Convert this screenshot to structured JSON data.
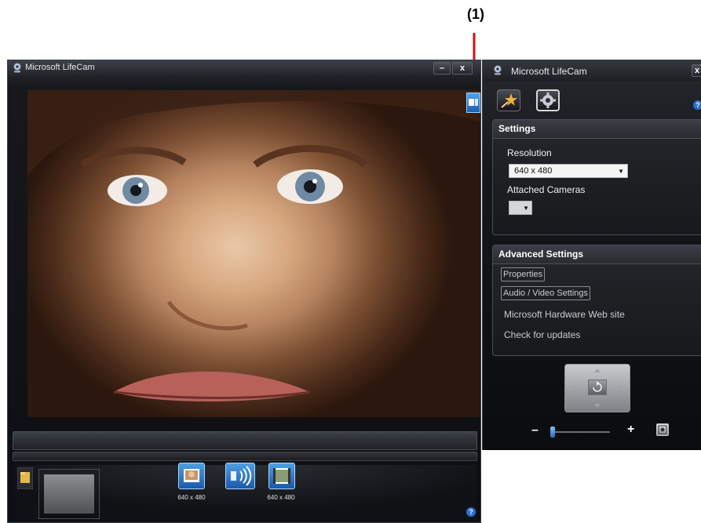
{
  "annotation": {
    "label": "(1)",
    "arrow_color": "#d01010"
  },
  "main_window": {
    "title": "Microsoft LifeCam",
    "minimize_symbol": "–",
    "close_symbol": "x",
    "capture_buttons": [
      {
        "icon": "photo-icon",
        "caption": "640 x 480"
      },
      {
        "icon": "record-audio-video-icon",
        "caption": ""
      },
      {
        "icon": "video-icon",
        "caption": "640 x 480"
      }
    ],
    "help_symbol": "?"
  },
  "settings_window": {
    "title": "Microsoft LifeCam",
    "close_symbol": "x",
    "help_symbol": "?",
    "settings_section": {
      "header": "Settings",
      "resolution_label": "Resolution",
      "resolution_value": "640 x 480",
      "attached_cameras_label": "Attached Cameras",
      "attached_cameras_value": ""
    },
    "advanced_section": {
      "header": "Advanced Settings",
      "properties_label": "Properties",
      "audio_video_label": "Audio / Video Settings",
      "hardware_site_label": "Microsoft Hardware Web site",
      "updates_label": "Check for updates"
    },
    "zoom": {
      "minus_symbol": "–",
      "plus_symbol": "+",
      "level": 0.0
    }
  },
  "colors": {
    "accent_blue": "#2a7fd6",
    "panel_bg": "#15171a",
    "annotation_red": "#d01010"
  }
}
